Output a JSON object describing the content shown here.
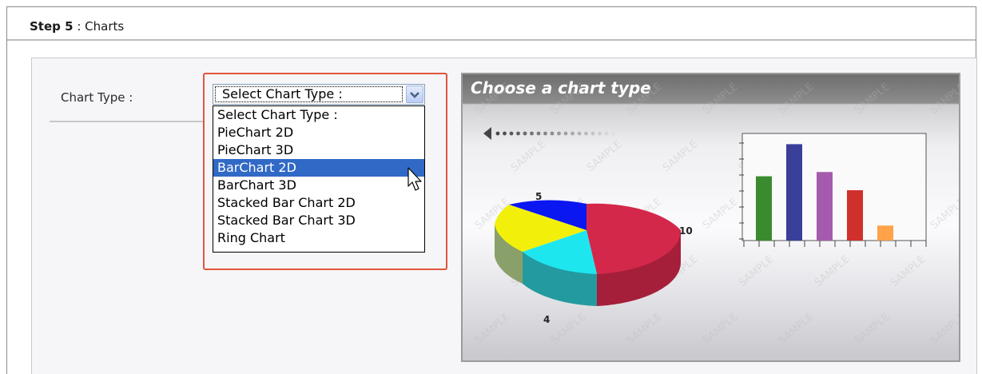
{
  "step": {
    "number_label": "Step 5",
    "separator": " : ",
    "title": "Charts"
  },
  "form": {
    "chart_type_label": "Chart Type :",
    "select": {
      "selected_value": "Select Chart Type :",
      "options": [
        "Select Chart Type :",
        "PieChart 2D",
        "PieChart 3D",
        "BarChart 2D",
        "BarChart 3D",
        "Stacked Bar Chart 2D",
        "Stacked Bar Chart 3D",
        "Ring Chart"
      ],
      "highlighted_index": 3
    }
  },
  "preview": {
    "title": "Choose a chart type",
    "watermark": "SAMPLE",
    "pie": {
      "labels": [
        "5",
        "10",
        "4"
      ],
      "colors": [
        "#0a17f0",
        "#d4284a",
        "#1ee6ef",
        "#f2f00a"
      ]
    },
    "bars": {
      "colors": [
        "#3a8a2f",
        "#3a3f9a",
        "#a55bad",
        "#d0302c",
        "#ffa24a"
      ],
      "values": [
        0.6,
        0.9,
        0.64,
        0.47,
        0.14
      ]
    }
  },
  "colors": {
    "highlight_border": "#e0553d",
    "selection": "#3169c6"
  }
}
